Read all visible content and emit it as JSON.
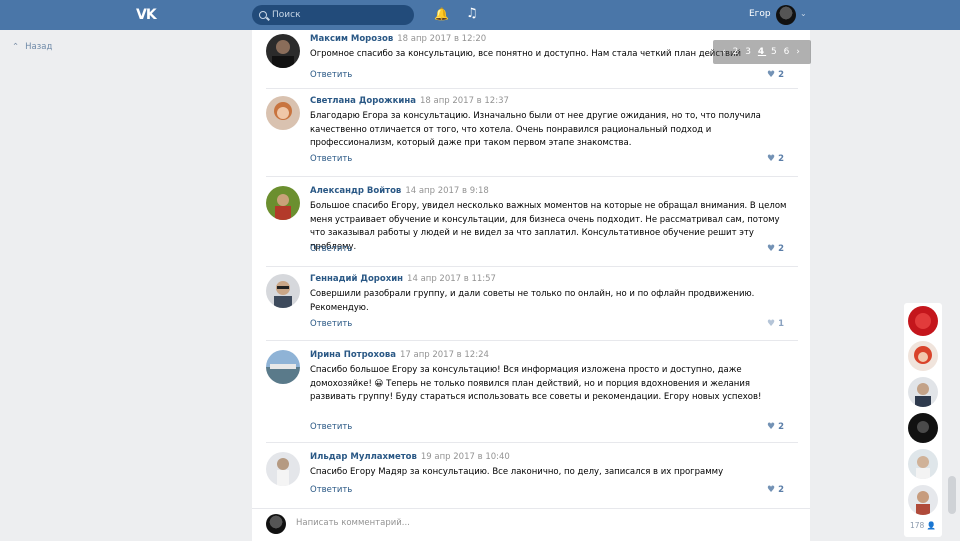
{
  "header": {
    "logo": "VK",
    "search_placeholder": "Поиск",
    "user_name": "Егор"
  },
  "nav": {
    "back_label": "Назад"
  },
  "pager": {
    "prev": "‹",
    "pages": [
      "2",
      "3",
      "4",
      "5",
      "6"
    ],
    "current": "4",
    "next": "›"
  },
  "comments": [
    {
      "name": "Максим Морозов",
      "date": "18 апр 2017 в 12:20",
      "text": "Огромное спасибо за консультацию, все понятно и доступно. Нам стала четкий план действий",
      "reply": "Ответить",
      "likes": "2"
    },
    {
      "name": "Светлана Дорожкина",
      "date": "18 апр 2017 в 12:37",
      "text": "Благодарю Егора за консультацию. Изначально были от нее другие ожидания, но то, что получила качественно отличается от того, что хотела. Очень понравился рациональный подход и профессионализм, который даже при таком первом этапе знакомства.",
      "reply": "Ответить",
      "likes": "2"
    },
    {
      "name": "Александр Войтов",
      "date": "14 апр 2017 в 9:18",
      "text": "Большое спасибо Егору, увидел несколько важных моментов на которые не обращал внимания. В целом меня устраивает обучение и консультации, для бизнеса очень подходит. Не рассматривал сам, потому что заказывал работы у людей и не видел за что заплатил. Консультативное обучение решит эту проблему.",
      "reply": "Ответить",
      "likes": "2"
    },
    {
      "name": "Геннадий Дорохин",
      "date": "14 апр 2017 в 11:57",
      "text": "Совершили разобрали группу, и дали советы не только по онлайн, но и по офлайн продвижению. Рекомендую.",
      "reply": "Ответить",
      "likes": "1"
    },
    {
      "name": "Ирина Потрохова",
      "date": "17 апр 2017 в 12:24",
      "text": "Спасибо большое Егору за консультацию! Вся информация изложена просто и доступно, даже домохозяйке! 😀 Теперь не только появился план действий, но и порция вдохновения и желания развивать группу! Буду стараться использовать все советы и рекомендации. Егору новых успехов!",
      "reply": "Ответить",
      "likes": "2"
    },
    {
      "name": "Ильдар Муллахметов",
      "date": "19 апр 2017 в 10:40",
      "text": "Спасибо Егору Мадяр за консультацию. Все лаконично, по делу, записался в их программу",
      "reply": "Ответить",
      "likes": "2"
    }
  ],
  "comment_input": {
    "placeholder": "Написать комментарий..."
  },
  "friends_panel": {
    "count": "178"
  },
  "colors": {
    "header": "#4a76a8",
    "link": "#2a5885",
    "background": "#edeef0"
  }
}
